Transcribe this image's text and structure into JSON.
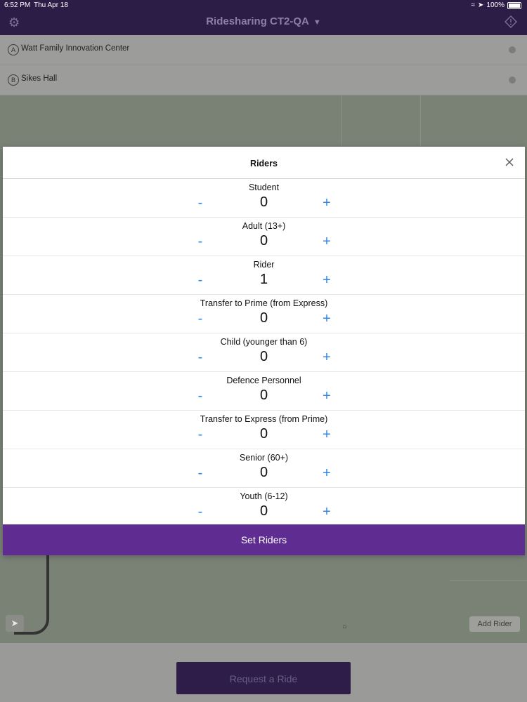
{
  "status": {
    "time": "6:52 PM",
    "date": "Thu Apr 18",
    "battery": "100%"
  },
  "app": {
    "title": "Ridesharing CT2-QA"
  },
  "locations": [
    {
      "badge": "A",
      "name": "Watt Family Innovation Center"
    },
    {
      "badge": "B",
      "name": "Sikes Hall"
    }
  ],
  "modal": {
    "title": "Riders",
    "minus_label": "-",
    "plus_label": "+",
    "riders": [
      {
        "label": "Student",
        "count": "0"
      },
      {
        "label": "Adult (13+)",
        "count": "0"
      },
      {
        "label": "Rider",
        "count": "1"
      },
      {
        "label": "Transfer to Prime (from Express)",
        "count": "0"
      },
      {
        "label": "Child (younger than 6)",
        "count": "0"
      },
      {
        "label": "Defence Personnel",
        "count": "0"
      },
      {
        "label": "Transfer to Express (from Prime)",
        "count": "0"
      },
      {
        "label": "Senior (60+)",
        "count": "0"
      },
      {
        "label": "Youth (6-12)",
        "count": "0"
      }
    ],
    "set_riders_label": "Set Riders"
  },
  "map": {
    "add_rider_label": "Add Rider"
  },
  "footer": {
    "request_label": "Request a Ride"
  },
  "colors": {
    "accent": "#5f2d91",
    "header": "#2c1d47",
    "stepper": "#2f86e4"
  },
  "icons": {
    "settings": "gear-icon",
    "alert": "alert-icon",
    "close": "close-icon",
    "locate": "location-arrow-icon"
  }
}
